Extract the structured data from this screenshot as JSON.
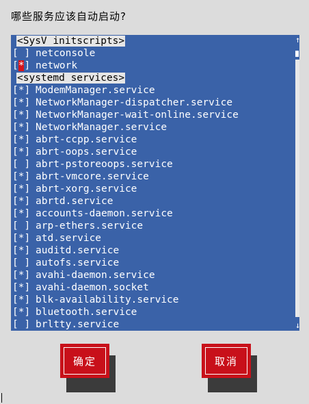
{
  "dialog": {
    "title": "哪些服务应该自动启动?"
  },
  "sections": [
    {
      "header": "<SysV initscripts>",
      "items": [
        {
          "name": "netconsole",
          "checked": false
        },
        {
          "name": "network",
          "checked": true,
          "focused": true
        }
      ]
    },
    {
      "header": "<systemd services>",
      "items": [
        {
          "name": "ModemManager.service",
          "checked": true
        },
        {
          "name": "NetworkManager-dispatcher.service",
          "checked": true
        },
        {
          "name": "NetworkManager-wait-online.service",
          "checked": true
        },
        {
          "name": "NetworkManager.service",
          "checked": true
        },
        {
          "name": "abrt-ccpp.service",
          "checked": true
        },
        {
          "name": "abrt-oops.service",
          "checked": true
        },
        {
          "name": "abrt-pstoreoops.service",
          "checked": false
        },
        {
          "name": "abrt-vmcore.service",
          "checked": true
        },
        {
          "name": "abrt-xorg.service",
          "checked": true
        },
        {
          "name": "abrtd.service",
          "checked": true
        },
        {
          "name": "accounts-daemon.service",
          "checked": true
        },
        {
          "name": "arp-ethers.service",
          "checked": false
        },
        {
          "name": "atd.service",
          "checked": true
        },
        {
          "name": "auditd.service",
          "checked": true
        },
        {
          "name": "autofs.service",
          "checked": false
        },
        {
          "name": "avahi-daemon.service",
          "checked": true
        },
        {
          "name": "avahi-daemon.socket",
          "checked": true
        },
        {
          "name": "blk-availability.service",
          "checked": true
        },
        {
          "name": "bluetooth.service",
          "checked": true
        },
        {
          "name": "brltty.service",
          "checked": false
        }
      ]
    }
  ],
  "buttons": {
    "ok": "确定",
    "cancel": "取消"
  },
  "scroll": {
    "up_arrow": "↑",
    "down_arrow": "↓"
  },
  "colors": {
    "list_bg": "#3a62a8",
    "button_red": "#c8101a",
    "background": "#dcdcdc"
  }
}
